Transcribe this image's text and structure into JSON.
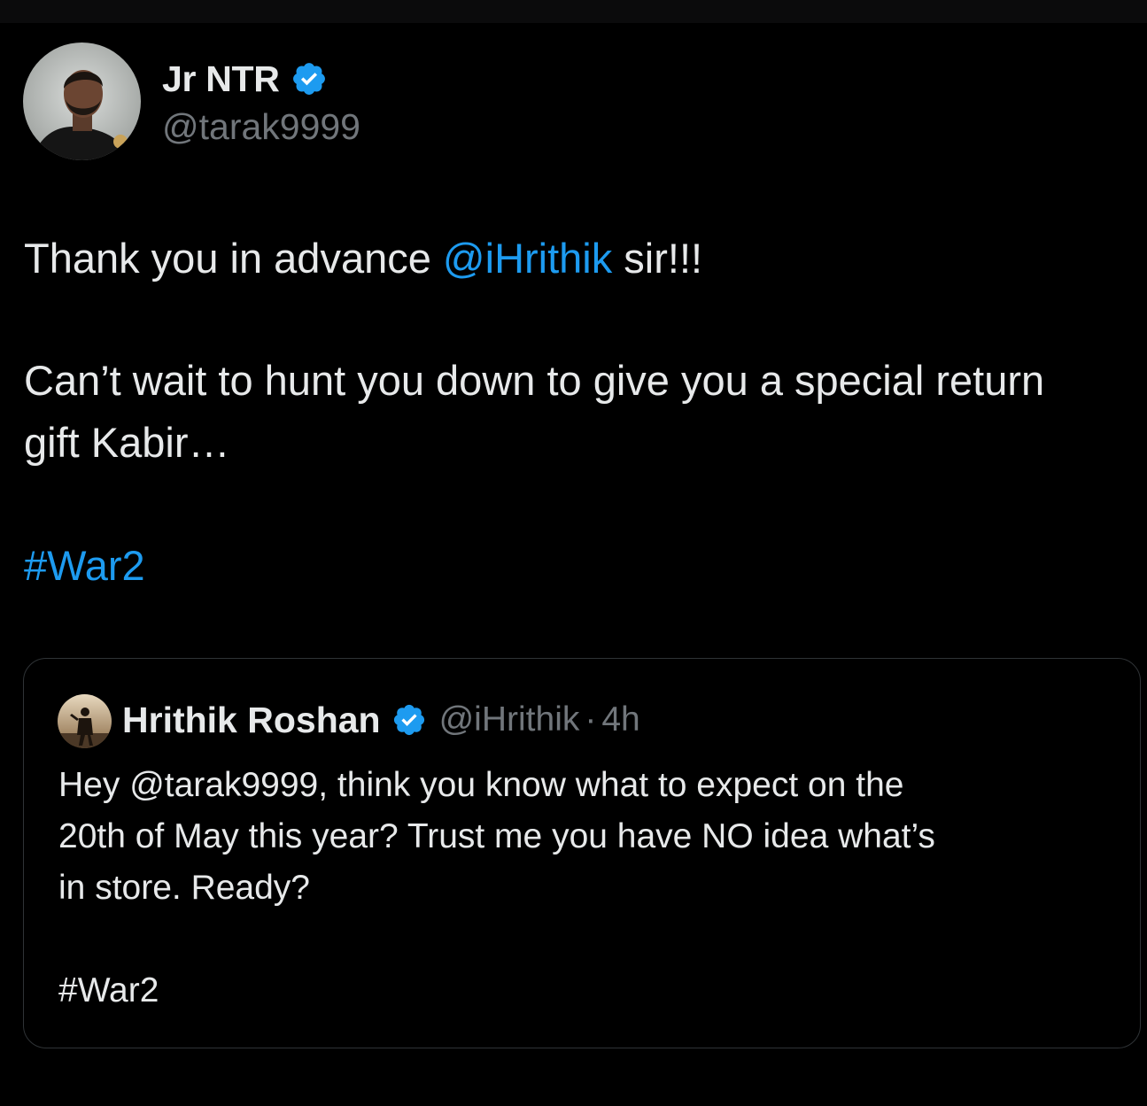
{
  "tweet": {
    "author": {
      "name": "Jr NTR",
      "handle": "@tarak9999",
      "avatar_icon": "profile-photo",
      "verified_icon": "verified-badge-icon"
    },
    "body": {
      "line1_prefix": "Thank you in advance ",
      "line1_mention": "@iHrithik",
      "line1_suffix": " sir!!!",
      "line2": "Can’t wait to hunt you down to give you a special return",
      "line3": "gift Kabir…",
      "hashtag": "#War2"
    },
    "quoted": {
      "name": "Hrithik Roshan",
      "handle": "@iHrithik",
      "separator": "·",
      "time": "4h",
      "avatar_icon": "profile-photo",
      "verified_icon": "verified-badge-icon",
      "line1": "Hey @tarak9999, think you know what to expect on the",
      "line2": "20th of May this year? Trust me you have NO idea what’s",
      "line3": "in store. Ready?",
      "hashtag": "#War2"
    }
  },
  "colors": {
    "background": "#000000",
    "text": "#e7e9ea",
    "secondary_text": "#71767b",
    "link": "#1d9bf0",
    "verified": "#1d9bf0",
    "border": "#2f3336"
  }
}
